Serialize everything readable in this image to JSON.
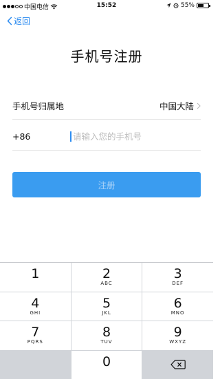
{
  "status_bar": {
    "carrier": "中国电信",
    "time": "15:52",
    "battery": "55%",
    "battery_level": 0.55,
    "icons": [
      "signal-dots",
      "wifi-icon",
      "location-icon",
      "alarm-icon",
      "battery-icon"
    ]
  },
  "nav": {
    "back_label": "返回"
  },
  "page": {
    "title": "手机号注册"
  },
  "form": {
    "region_label": "手机号归属地",
    "region_value": "中国大陆",
    "country_code": "+86",
    "phone_placeholder": "请输入您的手机号",
    "phone_value": ""
  },
  "register_label": "注册",
  "colors": {
    "accent": "#3a9cf0",
    "link": "#2d8cf0",
    "keypad_bg": "#d1d4d9"
  },
  "keypad": {
    "keys": [
      {
        "digit": "1",
        "letters": ""
      },
      {
        "digit": "2",
        "letters": "ABC"
      },
      {
        "digit": "3",
        "letters": "DEF"
      },
      {
        "digit": "4",
        "letters": "GHI"
      },
      {
        "digit": "5",
        "letters": "JKL"
      },
      {
        "digit": "6",
        "letters": "MNO"
      },
      {
        "digit": "7",
        "letters": "PQRS"
      },
      {
        "digit": "8",
        "letters": "TUV"
      },
      {
        "digit": "9",
        "letters": "WXYZ"
      },
      {
        "digit": "0",
        "letters": ""
      }
    ]
  }
}
